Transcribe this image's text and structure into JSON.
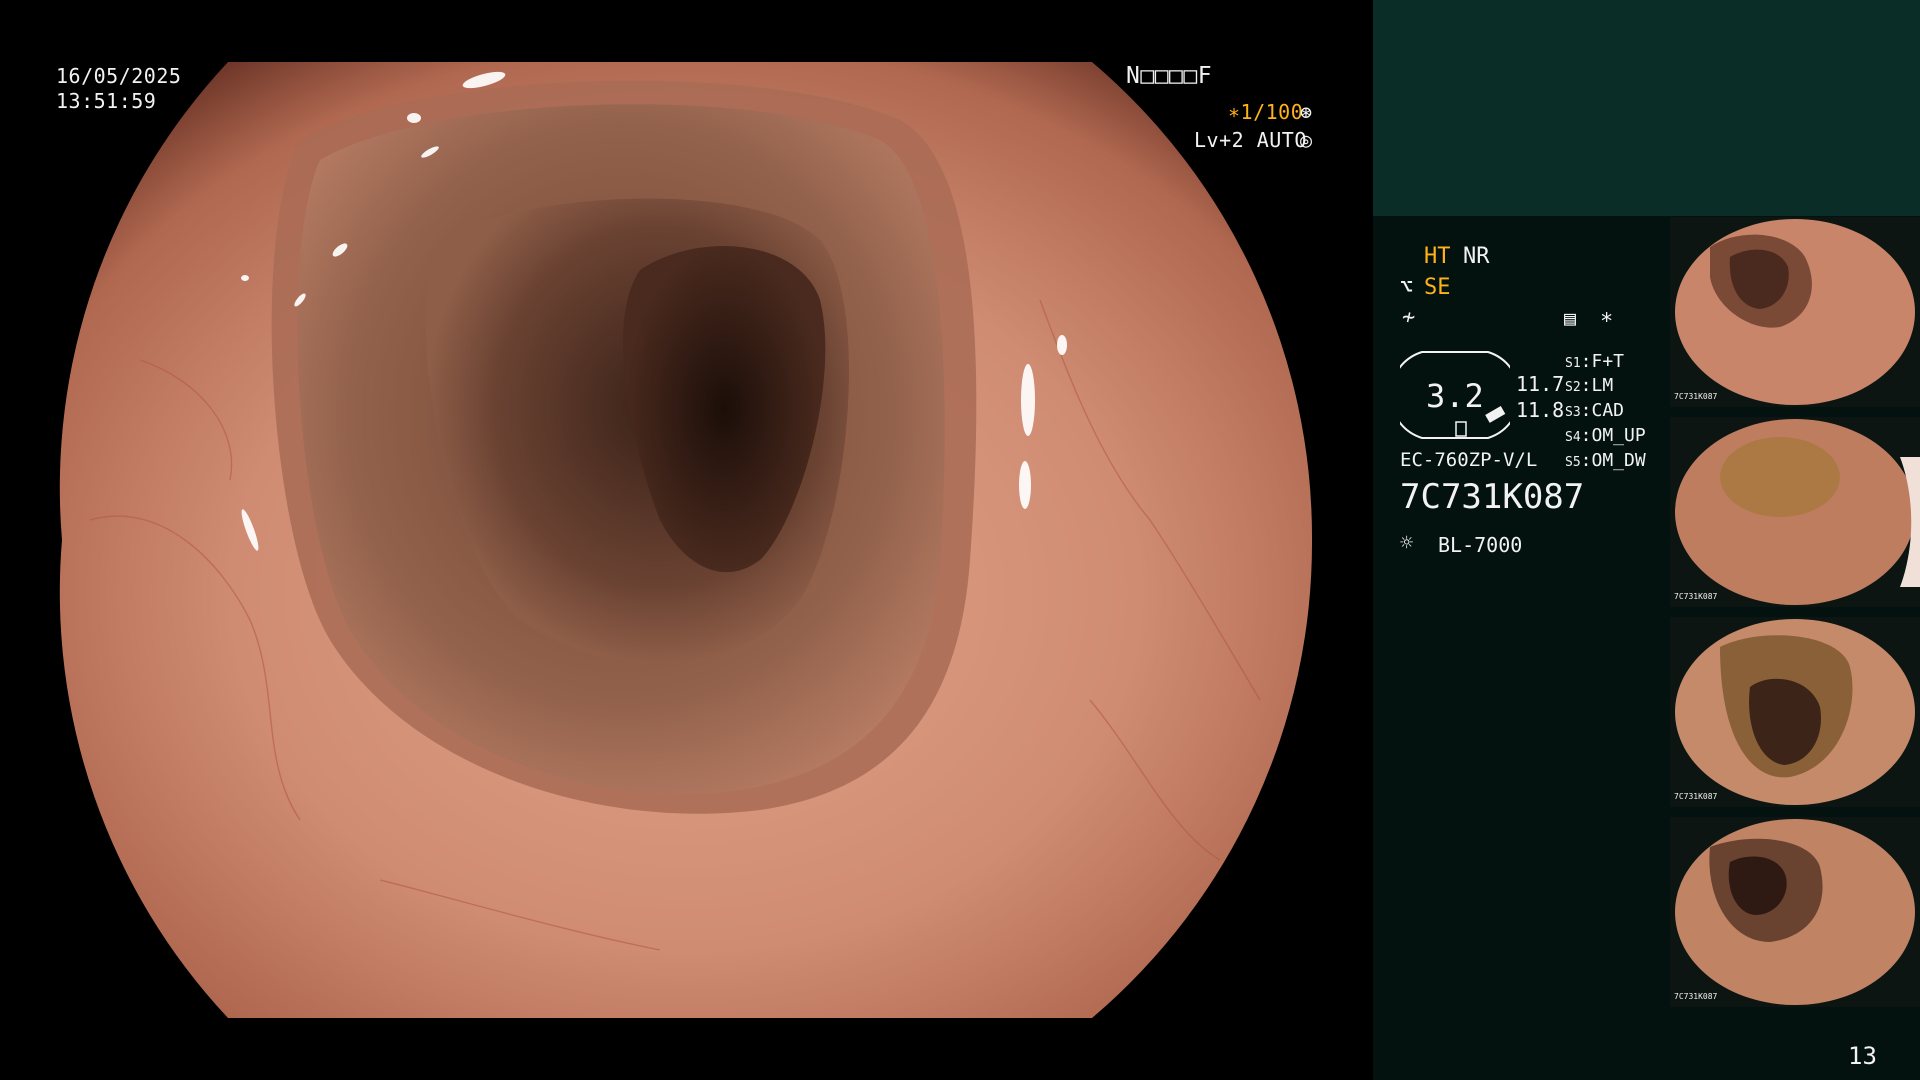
{
  "overlay": {
    "date": "16/05/2025",
    "time": "13:51:59",
    "code": "N□□□□F",
    "shutter": "∗1/100",
    "shutter_icon": "aperture-icon",
    "level": "Lv+2 AUTO",
    "level_icon": "auto-iris-icon"
  },
  "panel": {
    "ht": "HT",
    "nr": "NR",
    "se": "SE",
    "se_icon": "enhance-icon",
    "freeze_icon": "freeze-icon",
    "menu_icon": "settings-list-icon",
    "star": "∗",
    "zoom_value": "3.2",
    "value_top": "11.7",
    "value_bottom": "11.8",
    "scope_model": "EC-760ZP-V/L",
    "serial": "7C731K087",
    "light_icon": "light-source-icon",
    "light_source": "BL-7000",
    "switches": [
      {
        "key": "S1",
        "label": "F+T"
      },
      {
        "key": "S2",
        "label": "LM"
      },
      {
        "key": "S3",
        "label": "CAD"
      },
      {
        "key": "S4",
        "label": "OM_UP"
      },
      {
        "key": "S5",
        "label": "OM_DW"
      }
    ],
    "page_number": "13"
  },
  "thumbnails": [
    {
      "label": "7C731K087",
      "index": "12"
    },
    {
      "label": "7C731K087",
      "index": "11"
    },
    {
      "label": "7C731K087",
      "index": "10"
    },
    {
      "label": "7C731K087",
      "index": "9"
    }
  ],
  "colors": {
    "panel_bg": "#04120f",
    "panel_top": "#0b2d28",
    "accent_yellow": "#ffb21a",
    "mucosa": "#c98a70"
  }
}
